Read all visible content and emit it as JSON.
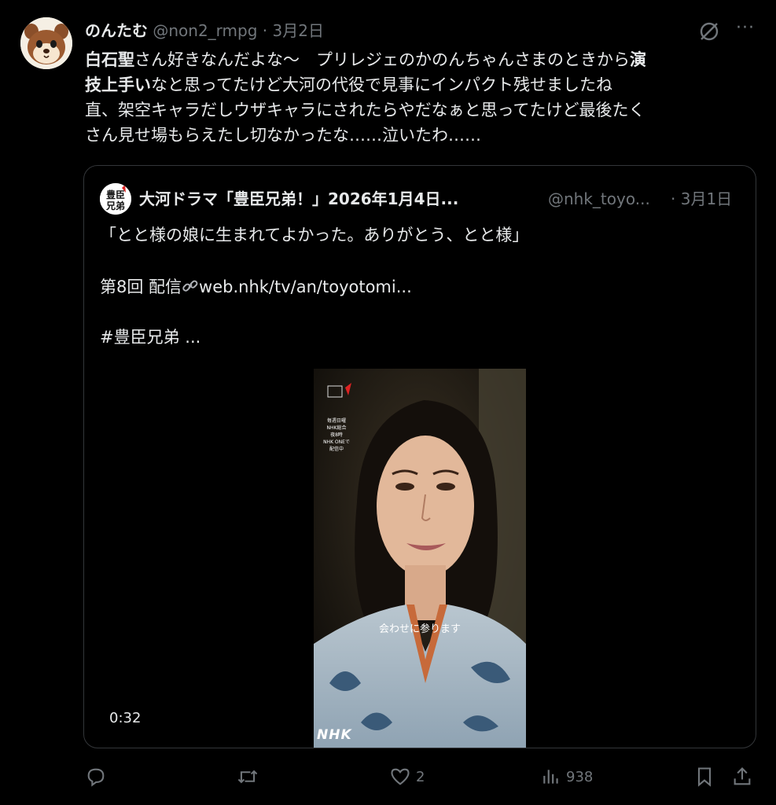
{
  "tweet": {
    "author_name": "のんたむ",
    "author_handle": "@non2_rmpg",
    "separator": "·",
    "date": "3月2日",
    "more_label": "···",
    "text_line1_a": "白石聖",
    "text_line1_b": "さん好きなんだよな〜　プリレジェのかのんちゃんさまのときから",
    "text_line1_c": "演",
    "text_line2_a": "技上手い",
    "text_line2_b": "なと思ってたけど大河の代役で見事にインパクト残せましたね",
    "text_line3": "直、架空キャラだしウザキャラにされたらやだなぁと思ってたけど最後たく",
    "text_line4": "さん見せ場もらえたし切なかったな……泣いたわ……"
  },
  "quote": {
    "name": "大河ドラマ「豊臣兄弟！」2026年1月4日...",
    "handle": "@nhk_toyo...",
    "separator": "·",
    "date": "3月1日",
    "text1": "「とと様の娘に生まれてよかった。ありがとう、とと様」",
    "text2_prefix": "第8回 配信",
    "link": "web.nhk/tv/an/toyotomi...",
    "hashtag": "#豊臣兄弟 ...",
    "video": {
      "duration": "0:32",
      "subtitle": "会わせに参ります",
      "promo_line1": "毎週日曜",
      "promo_line2": "NHK総合",
      "promo_line3": "夜8時",
      "promo_line4": "NHK ONEで",
      "promo_line5": "配信中",
      "watermark": "NHK"
    }
  },
  "actions": {
    "replies": "",
    "reposts": "",
    "likes": "2",
    "views": "938"
  },
  "colors": {
    "background": "#000000",
    "text": "#e7e9ea",
    "muted": "#71767b",
    "border": "#333639"
  }
}
